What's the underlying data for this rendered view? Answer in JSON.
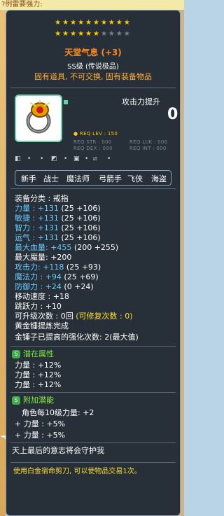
{
  "background": {
    "top_text": "?例雷要强力:"
  },
  "header": {
    "stars_row1": "★★★★★★★★★★",
    "stars_row2_gold": "★★★★★★",
    "stars_row2_grey": "★★★★",
    "star_gold": "#ffcc00",
    "star_grey": "#7b808a",
    "name": "天堂气息 (+3)",
    "grade": "SS级 (传说极品)",
    "warning": "固有道具, 不可交换, 固有装备物品"
  },
  "requirements": {
    "req_lev": "● REQ LEV : 150",
    "req_str": "REQ STR : 000",
    "req_dex": "REQ DEX : 000",
    "req_luk": "REQ LUK : 000",
    "req_int": "REQ INT : 000"
  },
  "attack": {
    "label": "攻击力提升",
    "value": "0"
  },
  "jobs": [
    "新手",
    "战士",
    "魔法师",
    "弓箭手",
    "飞侠",
    "海盗"
  ],
  "stats": {
    "category": "装备分类 : 戒指",
    "str_label": "力量 : ",
    "str_value": "+131",
    "str_detail": "(25 +106)",
    "dex_label": "敏捷 : ",
    "dex_value": "+131",
    "dex_detail": "(25 +106)",
    "int_label": "智力 : ",
    "int_value": "+131",
    "int_detail": "(25 +106)",
    "luk_label": "运气 : ",
    "luk_value": "+131",
    "luk_detail": "(25 +106)",
    "hp_label": "最大血量: ",
    "hp_value": "+455",
    "hp_detail": "(200 +255)",
    "mp_label": "最大魔量: ",
    "mp_value": "+200",
    "atk_label": "攻击力: ",
    "atk_value": "+118",
    "atk_detail": "(25 +93)",
    "matk_label": "魔法力 : ",
    "matk_value": "+94",
    "matk_detail": "(25 +69)",
    "def_label": "防御力 : ",
    "def_value": "+24",
    "def_detail": "(0 +24)",
    "speed": "移动速度 : +18",
    "jump": "跳跃力 : +10",
    "upgrade": "可升级次数 : 0回",
    "upgrade_restore": "(可修复次数 : 0)",
    "hammer": "黄金锤提炼完成",
    "gold_hammer": "金锤子已提高的强化次数: 2(最大值)"
  },
  "potential": {
    "badge": "S",
    "title": "潜在属性",
    "lines": [
      "力量 : +12%",
      "力量 : +12%",
      "力量 : +12%"
    ]
  },
  "bonus_potential": {
    "badge": "S",
    "title": "附加潜能",
    "lines": [
      "角色每10级力量: +2",
      "+ 力量 : +5%",
      "+ 力量 : +5%"
    ]
  },
  "description": "天上最后的意志将会守护我",
  "footer": "使用白金宿命剪刀, 可以使物品交易1次。"
}
